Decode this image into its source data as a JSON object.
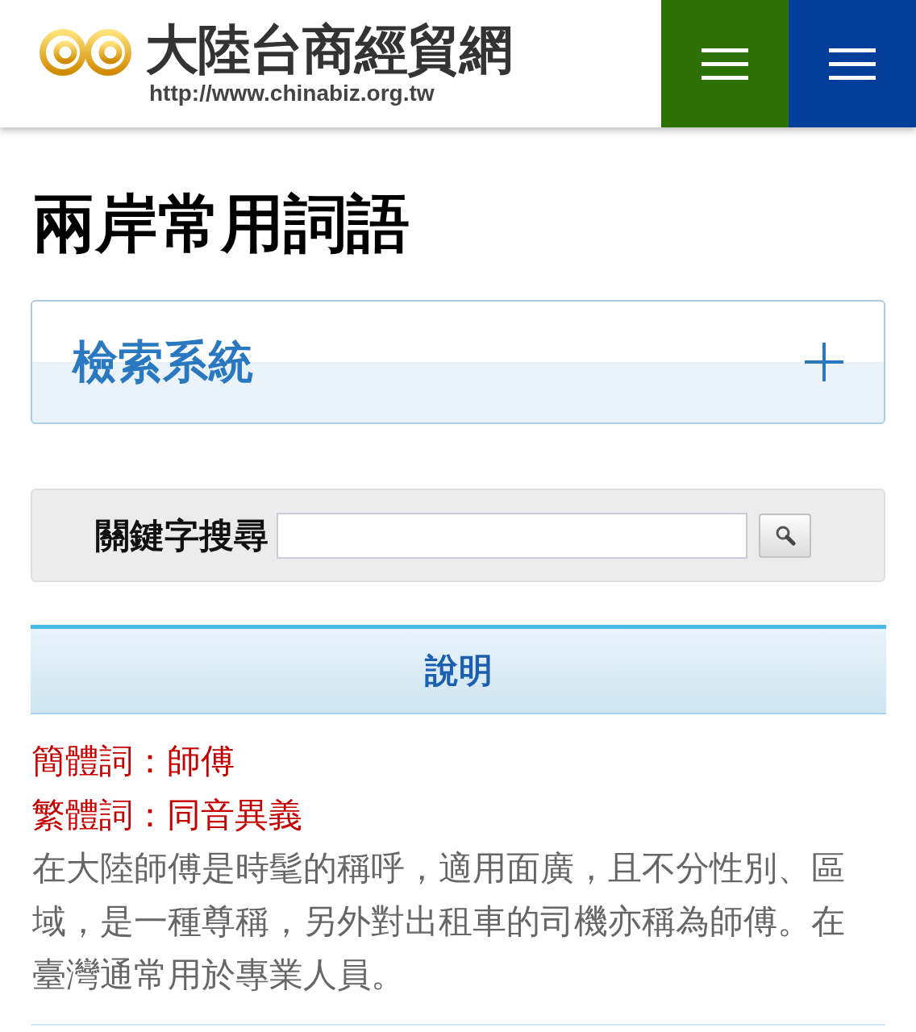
{
  "header": {
    "logo_title": "大陸台商經貿網",
    "logo_url": "http://www.chinabiz.org.tw",
    "menu_buttons": [
      {
        "color": "#2d7004"
      },
      {
        "color": "#033f9a"
      }
    ]
  },
  "page_title": "兩岸常用詞語",
  "accordion": {
    "title": "檢索系統",
    "expanded": false
  },
  "search": {
    "label": "關鍵字搜尋"
  },
  "explanation": {
    "heading": "說明",
    "terms": [
      "簡體詞：師傅",
      "繁體詞：同音異義"
    ],
    "body": "在大陸師傅是時髦的稱呼，適用面廣，且不分性別、區域，是一種尊稱，另外對出租車的司機亦稱為師傅。在臺灣通常用於專業人員。"
  }
}
